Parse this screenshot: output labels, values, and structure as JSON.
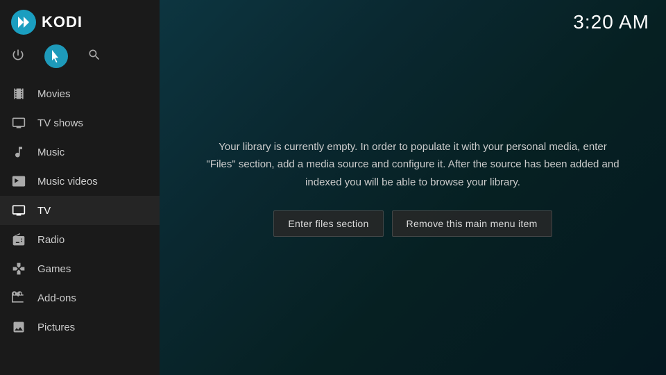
{
  "app": {
    "title": "KODI",
    "clock": "3:20 AM"
  },
  "sidebar": {
    "top_icons": [
      {
        "name": "power-icon",
        "symbol": "⏻",
        "interactable": true
      },
      {
        "name": "cursor-icon",
        "symbol": "↖",
        "interactable": true,
        "active": true
      },
      {
        "name": "search-icon",
        "symbol": "⌕",
        "interactable": true
      }
    ],
    "nav_items": [
      {
        "id": "movies",
        "label": "Movies",
        "icon": "movies"
      },
      {
        "id": "tv-shows",
        "label": "TV shows",
        "icon": "tv-shows"
      },
      {
        "id": "music",
        "label": "Music",
        "icon": "music"
      },
      {
        "id": "music-videos",
        "label": "Music videos",
        "icon": "music-videos"
      },
      {
        "id": "tv",
        "label": "TV",
        "icon": "tv",
        "active": true
      },
      {
        "id": "radio",
        "label": "Radio",
        "icon": "radio"
      },
      {
        "id": "games",
        "label": "Games",
        "icon": "games"
      },
      {
        "id": "add-ons",
        "label": "Add-ons",
        "icon": "add-ons"
      },
      {
        "id": "pictures",
        "label": "Pictures",
        "icon": "pictures"
      }
    ]
  },
  "main": {
    "library_message": "Your library is currently empty. In order to populate it with your personal media, enter \"Files\" section, add a media source and configure it. After the source has been added and indexed you will be able to browse your library.",
    "buttons": [
      {
        "id": "enter-files",
        "label": "Enter files section"
      },
      {
        "id": "remove-menu-item",
        "label": "Remove this main menu item"
      }
    ]
  }
}
